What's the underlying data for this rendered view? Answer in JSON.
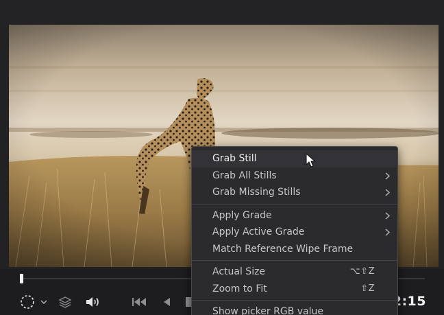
{
  "viewer": {
    "image_subject": "cheetah-in-grassland"
  },
  "context_menu": {
    "groups": [
      [
        {
          "label": "Grab Still",
          "submenu": false,
          "shortcut": ""
        },
        {
          "label": "Grab All Stills",
          "submenu": true,
          "shortcut": ""
        },
        {
          "label": "Grab Missing Stills",
          "submenu": true,
          "shortcut": ""
        }
      ],
      [
        {
          "label": "Apply Grade",
          "submenu": true,
          "shortcut": ""
        },
        {
          "label": "Apply Active Grade",
          "submenu": true,
          "shortcut": ""
        },
        {
          "label": "Match Reference Wipe Frame",
          "submenu": false,
          "shortcut": ""
        }
      ],
      [
        {
          "label": "Actual Size",
          "submenu": false,
          "shortcut": "⌥⇧Z"
        },
        {
          "label": "Zoom to Fit",
          "submenu": false,
          "shortcut": "⇧Z"
        }
      ],
      [
        {
          "label": "Show picker RGB value",
          "submenu": false,
          "shortcut": ""
        }
      ]
    ],
    "highlighted": "Grab Still"
  },
  "controls": {
    "timecode": "2:15",
    "icons": [
      "viewer-mode-icon",
      "chevron-down-icon",
      "layers-icon",
      "speaker-icon",
      "skip-to-start-icon",
      "play-reverse-icon",
      "stop-icon"
    ]
  },
  "colors": {
    "menu_bg": "#2b2b2e",
    "menu_text": "#c6c6c8",
    "app_bg": "#222224"
  }
}
